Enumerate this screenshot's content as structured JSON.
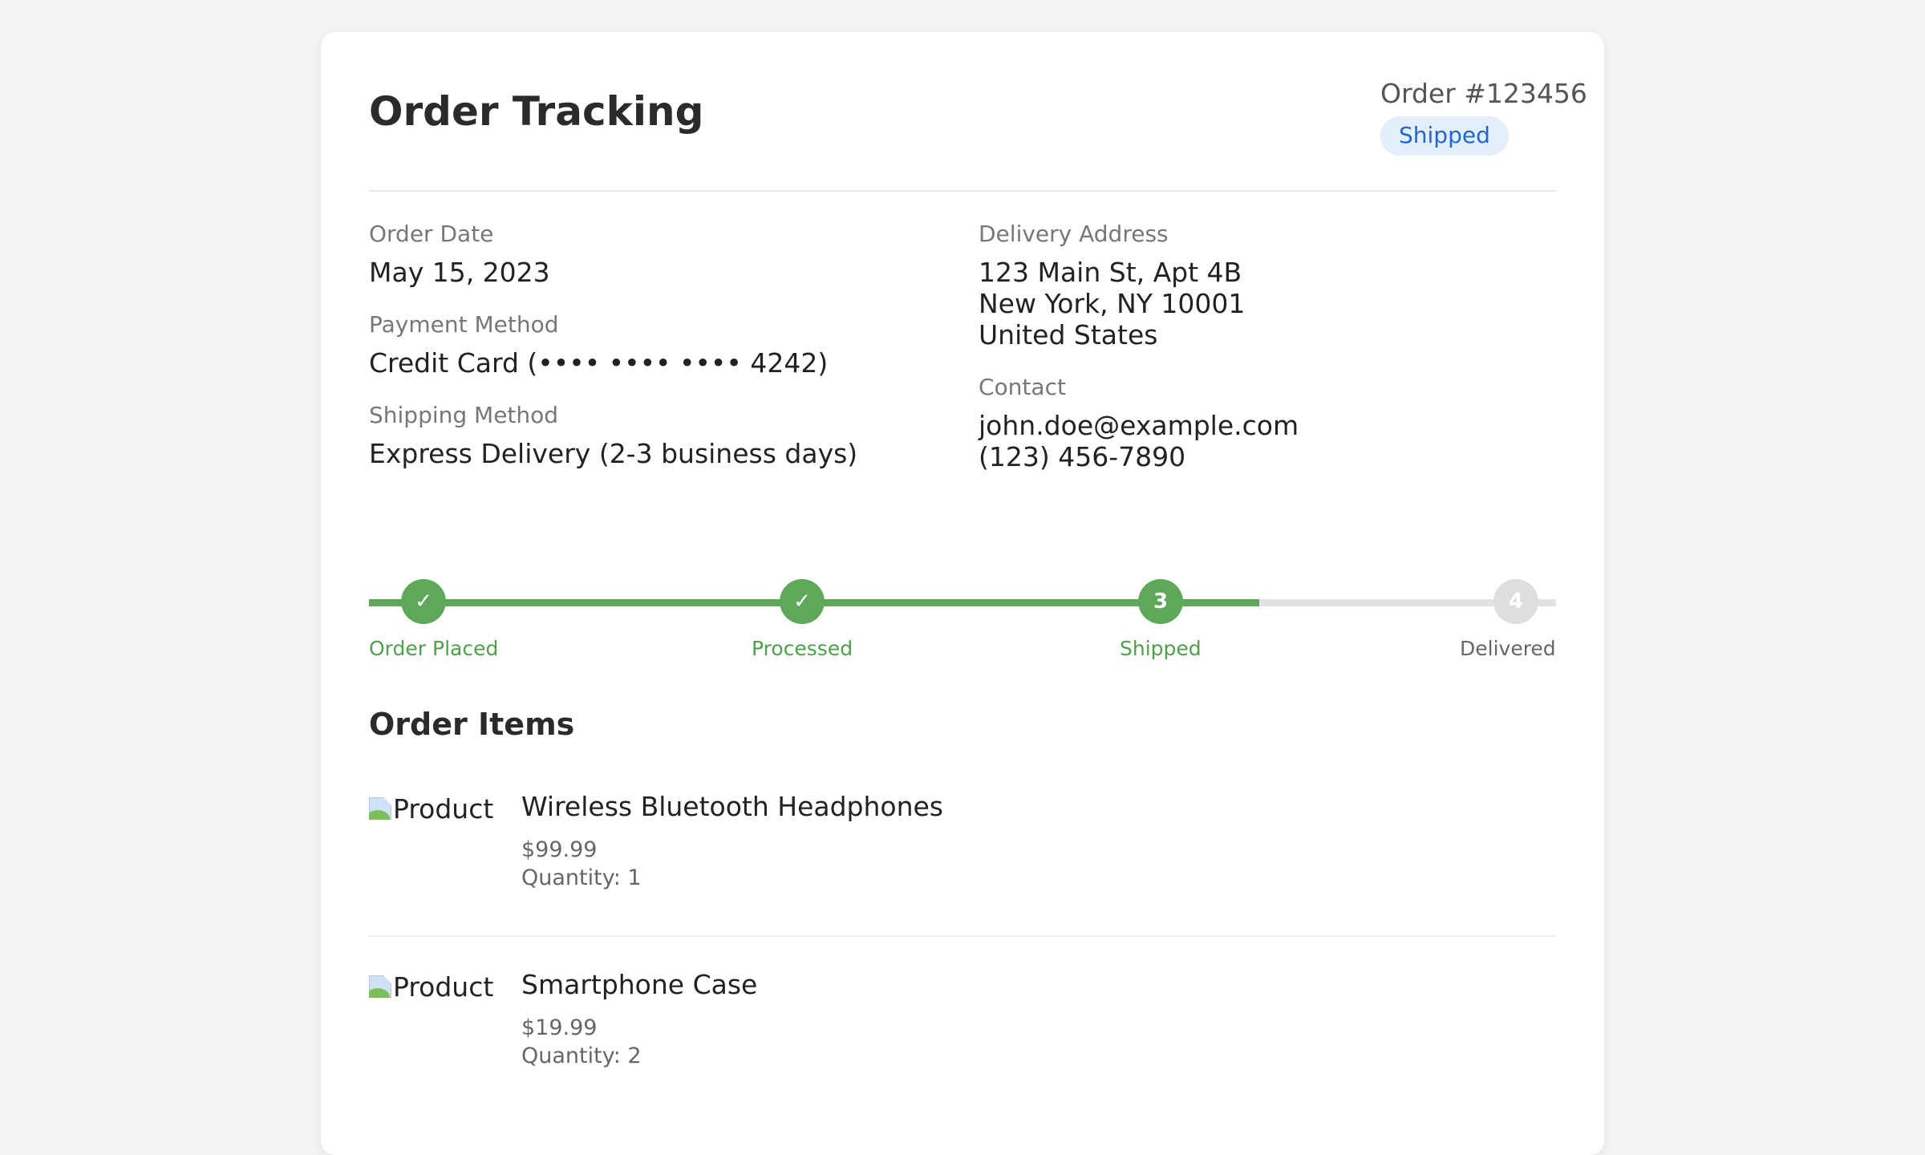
{
  "header": {
    "title": "Order Tracking",
    "order_number": "Order #123456",
    "status_badge": "Shipped"
  },
  "info": {
    "order_date_label": "Order Date",
    "order_date_value": "May 15, 2023",
    "payment_label": "Payment Method",
    "payment_value": "Credit Card (•••• •••• •••• 4242)",
    "shipping_label": "Shipping Method",
    "shipping_value": "Express Delivery (2-3 business days)",
    "address_label": "Delivery Address",
    "address_value": "123 Main St, Apt 4B\nNew York, NY 10001\nUnited States",
    "contact_label": "Contact",
    "contact_value": "john.doe@example.com\n(123) 456-7890"
  },
  "progress": {
    "completed_fraction": 0.75,
    "steps": [
      {
        "marker": "✓",
        "label": "Order Placed",
        "state": "complete"
      },
      {
        "marker": "✓",
        "label": "Processed",
        "state": "complete"
      },
      {
        "marker": "3",
        "label": "Shipped",
        "state": "current"
      },
      {
        "marker": "4",
        "label": "Delivered",
        "state": "pending"
      }
    ]
  },
  "items_section": {
    "title": "Order Items",
    "items": [
      {
        "image_alt": "Product",
        "name": "Wireless Bluetooth Headphones",
        "price": "$99.99",
        "quantity": "Quantity: 1"
      },
      {
        "image_alt": "Product",
        "name": "Smartphone Case",
        "price": "$19.99",
        "quantity": "Quantity: 2"
      }
    ]
  },
  "colors": {
    "accent_green": "#5ea85a",
    "badge_bg": "#e3eefb",
    "badge_text": "#2266cc",
    "pending_gray": "#dedede"
  }
}
